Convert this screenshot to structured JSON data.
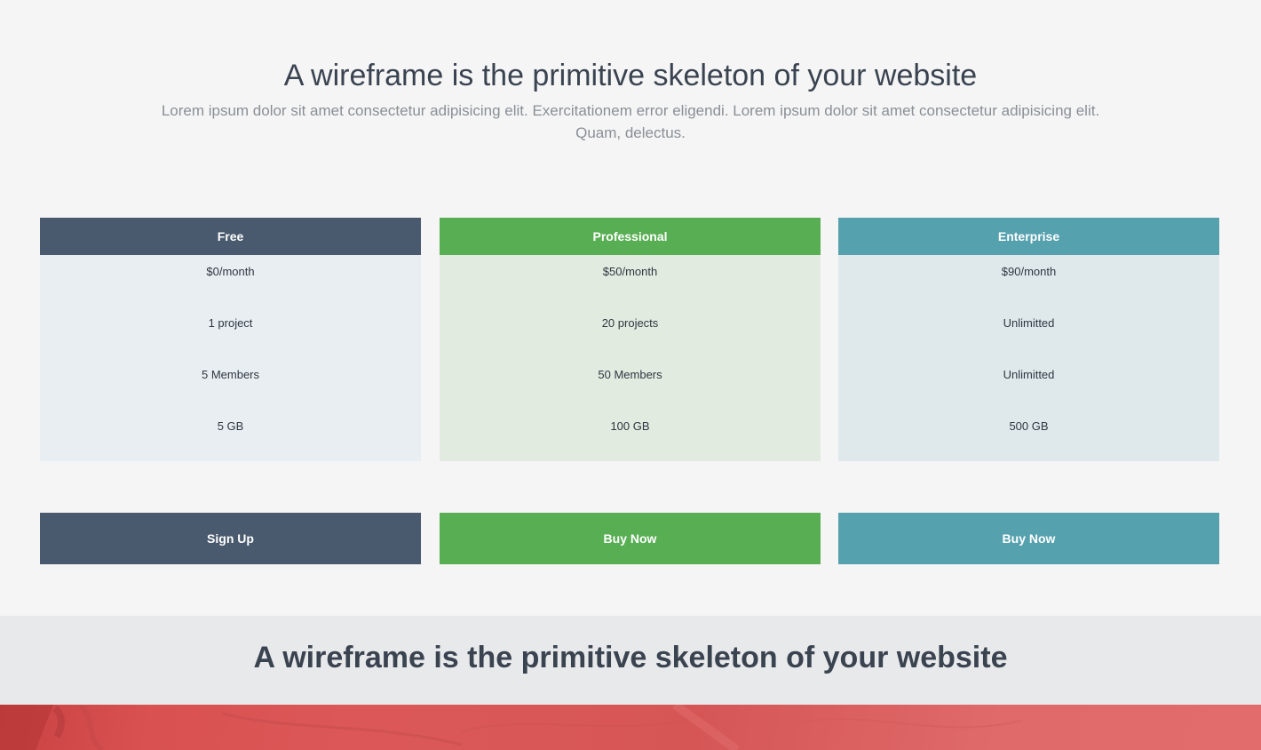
{
  "pricing": {
    "title": "A wireframe is the primitive skeleton of your website",
    "subtitle": "Lorem ipsum dolor sit amet consectetur adipisicing elit. Exercitationem error eligendi. Lorem ipsum dolor sit amet consectetur adipisicing elit. Quam, delectus.",
    "plans": [
      {
        "name": "Free",
        "price": "$0/month",
        "projects": "1 project",
        "members": "5 Members",
        "storage": "5 GB",
        "button": "Sign Up",
        "color": "#4a5a6e"
      },
      {
        "name": "Professional",
        "price": "$50/month",
        "projects": "20 projects",
        "members": "50 Members",
        "storage": "100 GB",
        "button": "Buy Now",
        "color": "#58ae52"
      },
      {
        "name": "Enterprise",
        "price": "$90/month",
        "projects": "Unlimitted",
        "members": "Unlimitted",
        "storage": "500 GB",
        "button": "Buy Now",
        "color": "#55a1ae"
      }
    ]
  },
  "band": {
    "title": "A wireframe is the primitive skeleton of your website"
  },
  "colors": {
    "background": "#f5f5f5",
    "band_background": "#e8e9eb",
    "hero_red": "#d95151"
  }
}
